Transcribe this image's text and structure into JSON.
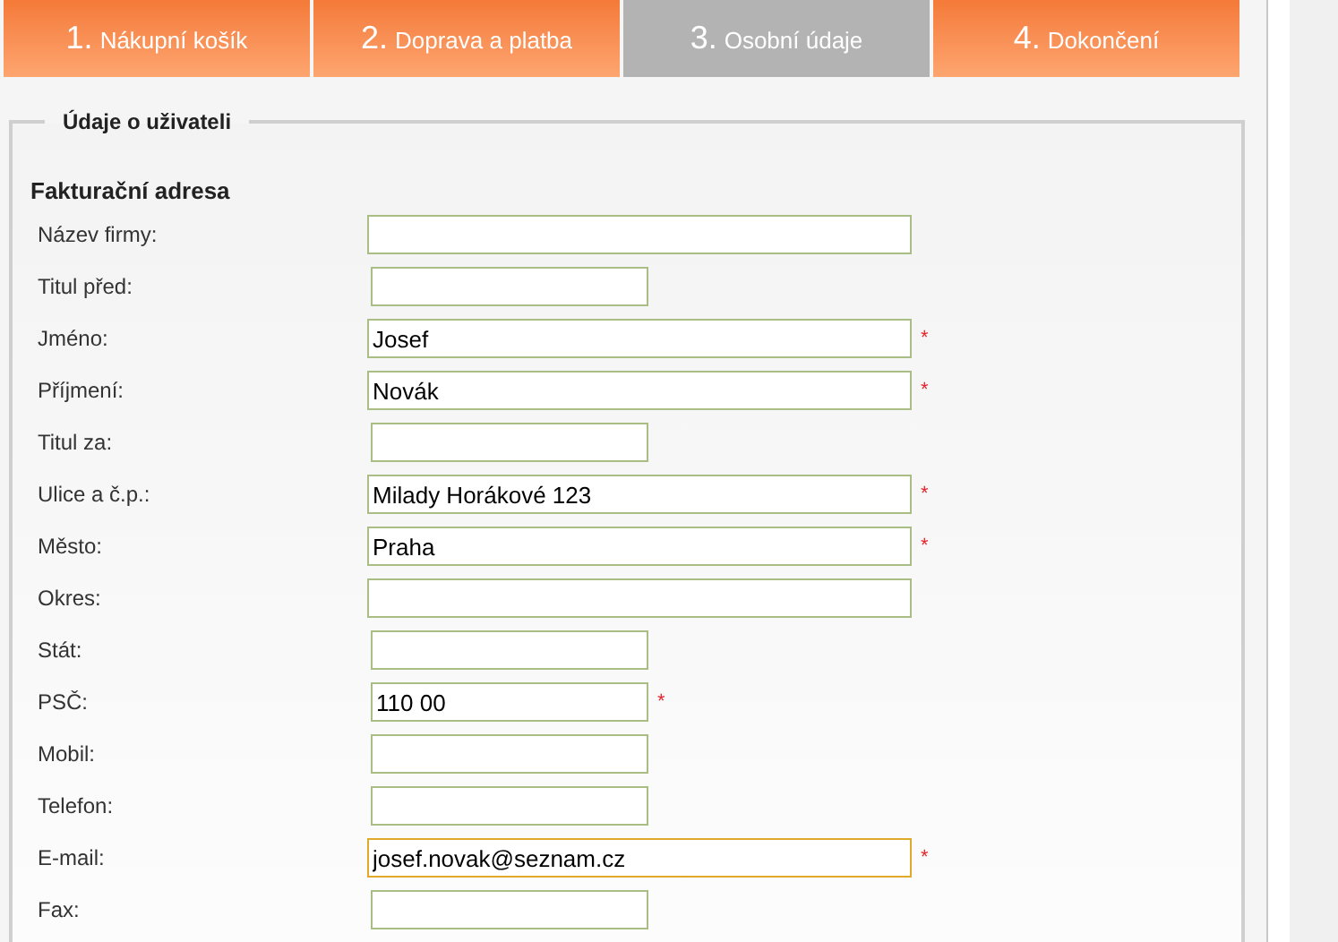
{
  "steps": [
    {
      "number": "1.",
      "label": "Nákupní košík",
      "selected": false
    },
    {
      "number": "2.",
      "label": "Doprava a platba",
      "selected": false
    },
    {
      "number": "3.",
      "label": "Osobní údaje",
      "selected": true
    },
    {
      "number": "4.",
      "label": "Dokončení",
      "selected": false
    }
  ],
  "section": {
    "legend": "Údaje o uživateli",
    "heading": "Fakturační adresa",
    "fields": [
      {
        "label": "Název firmy:",
        "kind": "wide",
        "required": false
      },
      {
        "label": "Titul před:",
        "kind": "narrow",
        "required": false
      },
      {
        "label": "Jméno:",
        "kind": "wide",
        "value": "Josef",
        "required": true
      },
      {
        "label": "Příjmení:",
        "kind": "wide",
        "value": "Novák",
        "required": true
      },
      {
        "label": "Titul za:",
        "kind": "narrow",
        "required": false
      },
      {
        "label": "Ulice a č.p.:",
        "kind": "wide",
        "value": "Milady Horákové 123",
        "required": true
      },
      {
        "label": "Město:",
        "kind": "wide",
        "value": "Praha",
        "required": true
      },
      {
        "label": "Okres:",
        "kind": "wide",
        "required": false
      },
      {
        "label": "Stát:",
        "kind": "narrow",
        "required": false
      },
      {
        "label": "PSČ:",
        "kind": "narrow",
        "value": "110 00",
        "required": true
      },
      {
        "label": "Mobil:",
        "kind": "narrow",
        "required": false
      },
      {
        "label": "Telefon:",
        "kind": "narrow",
        "required": false
      },
      {
        "label": "E-mail:",
        "kind": "wide",
        "value": "josef.novak@seznam.cz",
        "required": true,
        "focused": true
      },
      {
        "label": "Fax:",
        "kind": "narrow",
        "required": false
      }
    ],
    "required_mark": "*"
  }
}
